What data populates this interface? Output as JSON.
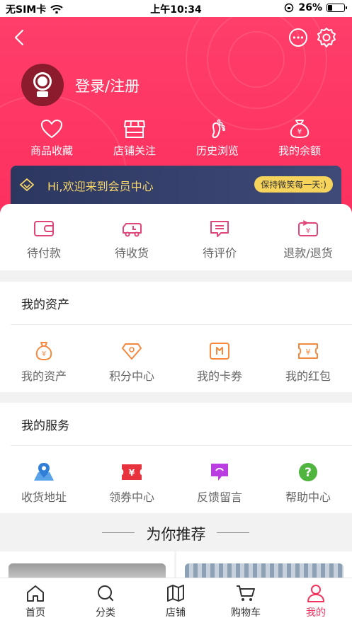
{
  "status_bar": {
    "carrier": "无SIM卡",
    "time": "上午10:34",
    "battery": "26%",
    "battery_level": 0.26
  },
  "header": {
    "login_text": "登录/注册",
    "quick_links": [
      {
        "label": "商品收藏",
        "icon": "heart-icon"
      },
      {
        "label": "店铺关注",
        "icon": "shop-icon"
      },
      {
        "label": "历史浏览",
        "icon": "footprint-icon"
      },
      {
        "label": "我的余额",
        "icon": "money-bag-icon"
      }
    ],
    "vip_banner": {
      "text": "Hi,欢迎来到会员中心",
      "badge": "保持微笑每一天:)"
    }
  },
  "orders": [
    {
      "label": "待付款",
      "icon": "wallet-icon"
    },
    {
      "label": "待收货",
      "icon": "delivery-truck-icon"
    },
    {
      "label": "待评价",
      "icon": "comment-icon"
    },
    {
      "label": "退款/退货",
      "icon": "refund-icon"
    }
  ],
  "assets": {
    "title": "我的资产",
    "items": [
      {
        "label": "我的资产",
        "icon": "money-bag-icon"
      },
      {
        "label": "积分中心",
        "icon": "diamond-icon"
      },
      {
        "label": "我的卡券",
        "icon": "card-icon"
      },
      {
        "label": "我的红包",
        "icon": "red-packet-icon"
      }
    ]
  },
  "services": {
    "title": "我的服务",
    "items": [
      {
        "label": "收货地址",
        "icon": "location-pin-icon"
      },
      {
        "label": "领券中心",
        "icon": "coupon-icon"
      },
      {
        "label": "反馈留言",
        "icon": "feedback-icon"
      },
      {
        "label": "帮助中心",
        "icon": "help-icon"
      }
    ]
  },
  "recommend": {
    "title": "为你推荐"
  },
  "tabbar": {
    "tabs": [
      {
        "label": "首页",
        "icon": "home-icon"
      },
      {
        "label": "分类",
        "icon": "search-icon"
      },
      {
        "label": "店铺",
        "icon": "store-map-icon"
      },
      {
        "label": "购物车",
        "icon": "cart-icon"
      },
      {
        "label": "我的",
        "icon": "profile-icon"
      }
    ],
    "active_index": 4
  },
  "colors": {
    "brand": "#f2335d",
    "header": "#fc2f5d",
    "vip_bg": "#2c3760",
    "vip_text": "#f7d76a",
    "asset_orange": "#f5883c"
  }
}
